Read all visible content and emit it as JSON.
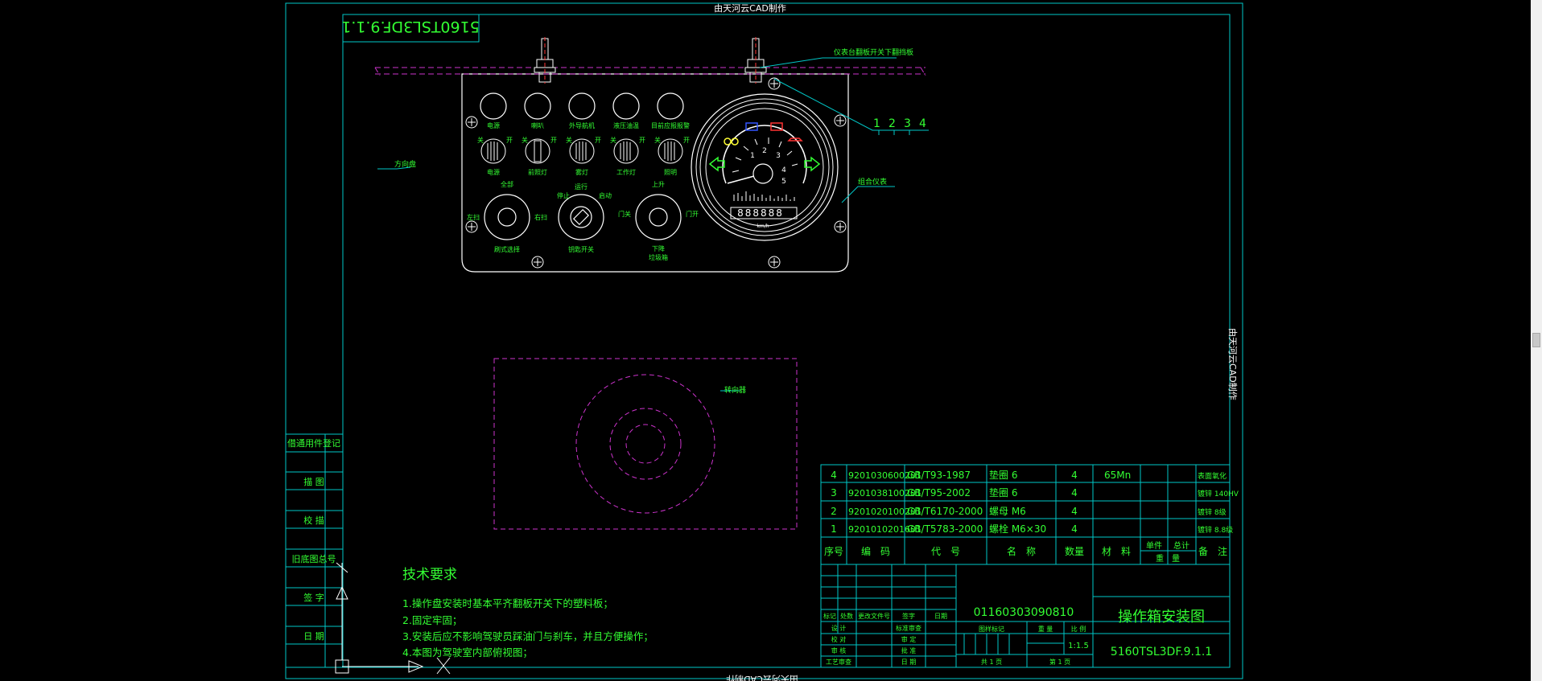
{
  "watermark": "由天河云CAD制作",
  "drawing_number_box": "5160TSL3DF.9.1.1",
  "callouts": {
    "leader_note": "仪表台翻板开关下翻挡板",
    "numbers": [
      "1",
      "2",
      "3",
      "4"
    ],
    "instrument": "组合仪表",
    "steering": "方向盘",
    "seat": "转向器"
  },
  "panel": {
    "top_labels": [
      "电源",
      "喇叭",
      "外导航机",
      "液压油温",
      "目前应报报警"
    ],
    "sw_on": "开",
    "sw_off": "关",
    "sw_labels": [
      "电源",
      "前照灯",
      "雾灯",
      "工作灯",
      "照明"
    ],
    "knob1": {
      "top": "全部",
      "left": "左扫",
      "right": "右扫",
      "bottom": "刷式选择"
    },
    "knob2": {
      "top": "运行",
      "left": "停止",
      "right": "启动",
      "bottom": "钥匙开关"
    },
    "knob3": {
      "top": "上升",
      "left": "门关",
      "right": "门开",
      "bottom1": "下降",
      "bottom2": "垃圾箱"
    }
  },
  "gauge": {
    "ticks": [
      "1",
      "2",
      "3",
      "4",
      "5"
    ],
    "odometer": "888888",
    "unit": "km/h"
  },
  "side_labels": [
    "借通用件登记",
    "描 图",
    "校 描",
    "旧底图总号",
    "签 字",
    "日 期"
  ],
  "tech": {
    "title": "技术要求",
    "items": [
      "1.操作盘安装时基本平齐翻板开关下的塑料板；",
      "2.固定牢固；",
      "3.安装后应不影响驾驶员踩油门与刹车，并且方便操作；",
      "4.本图为驾驶室内部俯视图；"
    ]
  },
  "bom": {
    "rows": [
      [
        "4",
        "9201030600201",
        "GB/T93-1987",
        "垫圈 6",
        "4",
        "65Mn",
        "",
        "",
        "表面氧化"
      ],
      [
        "3",
        "9201038100201",
        "GB/T95-2002",
        "垫圈 6",
        "4",
        "",
        "",
        "",
        "镀锌 140HV"
      ],
      [
        "2",
        "9201020100201",
        "GB/T6170-2000",
        "螺母 M6",
        "4",
        "",
        "",
        "",
        "镀锌 8级"
      ],
      [
        "1",
        "9201010201601",
        "GB/T5783-2000",
        "螺栓 M6×30",
        "4",
        "",
        "",
        "",
        "镀锌 8.8级"
      ]
    ],
    "header": [
      "序号",
      "编　码",
      "代　号",
      "名　称",
      "数量",
      "材　料",
      "单件",
      "总计",
      "备　注"
    ],
    "weight_label": "重　量"
  },
  "title_block": {
    "revision_headers": [
      "标记",
      "处数",
      "更改文件号",
      "签字",
      "日期"
    ],
    "roles_left": [
      "设 计",
      "校 对",
      "审 核",
      "工艺审查"
    ],
    "roles_right": [
      "标准审查",
      "审 定",
      "批 准",
      "日 期"
    ],
    "part_number": "01160303090810",
    "stage_label": "图样标记",
    "weight_label": "重 量",
    "scale_label": "比 例",
    "scale": "1:1.5",
    "sheets_total": "共 1 页",
    "sheet_no": "第 1 页",
    "title": "操作箱安装图",
    "drawing_no": "5160TSL3DF.9.1.1"
  },
  "colors": {
    "background": "#000000",
    "frame": "#00c8c8",
    "geometry": "#ffffff",
    "text": "#33ff33",
    "hidden_lines": "#cc33cc",
    "icon_blue": "#3355ff",
    "icon_red": "#ff3333",
    "icon_yellow": "#ffff33"
  }
}
